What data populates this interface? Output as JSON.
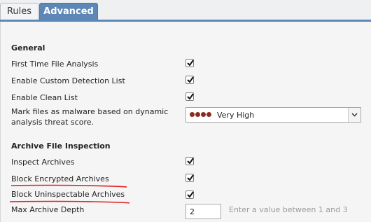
{
  "tabs": [
    {
      "label": "Rules",
      "active": false
    },
    {
      "label": "Advanced",
      "active": true
    }
  ],
  "general": {
    "title": "General",
    "first_time_file_analysis": {
      "label": "First Time File Analysis",
      "checked": true
    },
    "enable_custom_detection_list": {
      "label": "Enable Custom Detection List",
      "checked": true
    },
    "enable_clean_list": {
      "label": "Enable Clean List",
      "checked": true
    },
    "threat_score": {
      "label_line1": "Mark files as malware based on dynamic",
      "label_line2": "analysis threat score.",
      "value": "Very High",
      "indicator_dots": 4,
      "indicator_color": "#8b2b22"
    }
  },
  "archive": {
    "title": "Archive File Inspection",
    "inspect_archives": {
      "label": "Inspect Archives",
      "checked": true
    },
    "block_encrypted_archives": {
      "label": "Block Encrypted Archives",
      "checked": true
    },
    "block_uninspectable_archives": {
      "label": "Block Uninspectable Archives",
      "checked": true
    },
    "max_archive_depth": {
      "label": "Max Archive Depth",
      "value": "2",
      "hint": "Enter a value between 1 and 3"
    }
  },
  "colors": {
    "accent": "#5d87b7",
    "annotation": "#e02020"
  }
}
